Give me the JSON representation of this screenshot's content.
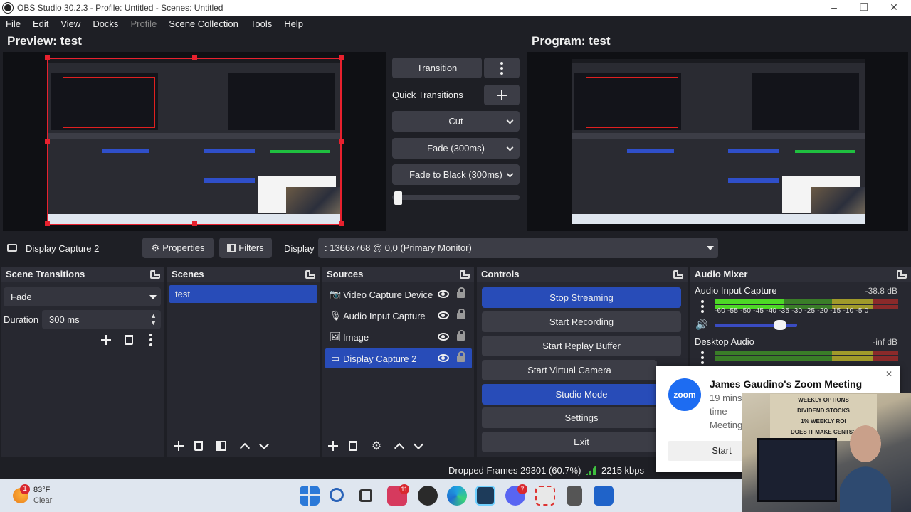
{
  "window": {
    "title": "OBS Studio 30.2.3 - Profile: Untitled - Scenes: Untitled",
    "minimize": "–",
    "restore": "❐",
    "close": "✕"
  },
  "menu": {
    "file": "File",
    "edit": "Edit",
    "view": "View",
    "docks": "Docks",
    "profile": "Profile",
    "scene_collection": "Scene Collection",
    "tools": "Tools",
    "help": "Help"
  },
  "preview": {
    "title": "Preview: test"
  },
  "program": {
    "title": "Program: test"
  },
  "transition_panel": {
    "transition_label": "Transition",
    "quick_transitions_label": "Quick Transitions",
    "cut_label": "Cut",
    "fade_label": "Fade (300ms)",
    "fade_black_label": "Fade to Black (300ms)",
    "tbar_position": 0.02
  },
  "source_toolbar": {
    "source_name": "Display Capture 2",
    "properties_label": "Properties",
    "filters_label": "Filters",
    "display_label": "Display",
    "display_value": ": 1366x768 @ 0,0 (Primary Monitor)"
  },
  "scene_transitions": {
    "title": "Scene Transitions",
    "selected": "Fade",
    "duration_label": "Duration",
    "duration_value": "300 ms"
  },
  "scenes": {
    "title": "Scenes",
    "items": [
      "test"
    ]
  },
  "sources": {
    "title": "Sources",
    "items": [
      {
        "name": "Video Capture Device",
        "icon": "camera-icon"
      },
      {
        "name": "Audio Input Capture",
        "icon": "microphone-icon"
      },
      {
        "name": "Image",
        "icon": "image-icon"
      },
      {
        "name": "Display Capture 2",
        "icon": "monitor-icon",
        "selected": true
      }
    ]
  },
  "controls": {
    "title": "Controls",
    "stop_streaming": "Stop Streaming",
    "start_recording": "Start Recording",
    "start_replay_buffer": "Start Replay Buffer",
    "start_virtual_camera": "Start Virtual Camera",
    "studio_mode": "Studio Mode",
    "settings": "Settings",
    "exit": "Exit"
  },
  "audio_mixer": {
    "title": "Audio Mixer",
    "channels": [
      {
        "name": "Audio Input Capture",
        "level": "-38.8 dB",
        "meter_fraction": 0.38,
        "volume_fraction": 0.85
      },
      {
        "name": "Desktop Audio",
        "level": "-inf dB",
        "meter_fraction": 0.0
      }
    ],
    "scale": "-60 -55 -50 -45 -40 -35 -30 -25 -20 -15 -10 -5 0"
  },
  "status": {
    "dropped_frames": "Dropped Frames 29301 (60.7%)",
    "bitrate": "2215 kbps"
  },
  "taskbar": {
    "weather_temp": "83°F",
    "weather_desc": "Clear",
    "weather_badge": "1",
    "zoom_badge": "11",
    "discord_badge": "7"
  },
  "toast": {
    "title": "James Gaudino's Zoom Meeting",
    "line1": "19 mins",
    "line2": "time",
    "line3": "Meeting",
    "start_label": "Start",
    "app_label": "zoom",
    "close": "✕"
  },
  "webcam_overlay": {
    "sign_lines": [
      "WEEKLY OPTIONS",
      "DIVIDEND STOCKS",
      "1% WEEKLY ROI",
      "DOES IT MAKE CENTS?"
    ]
  },
  "colors": {
    "accent": "#284cb8",
    "selection_red": "#e8212e",
    "panel": "#272830",
    "background": "#1e1f25"
  }
}
